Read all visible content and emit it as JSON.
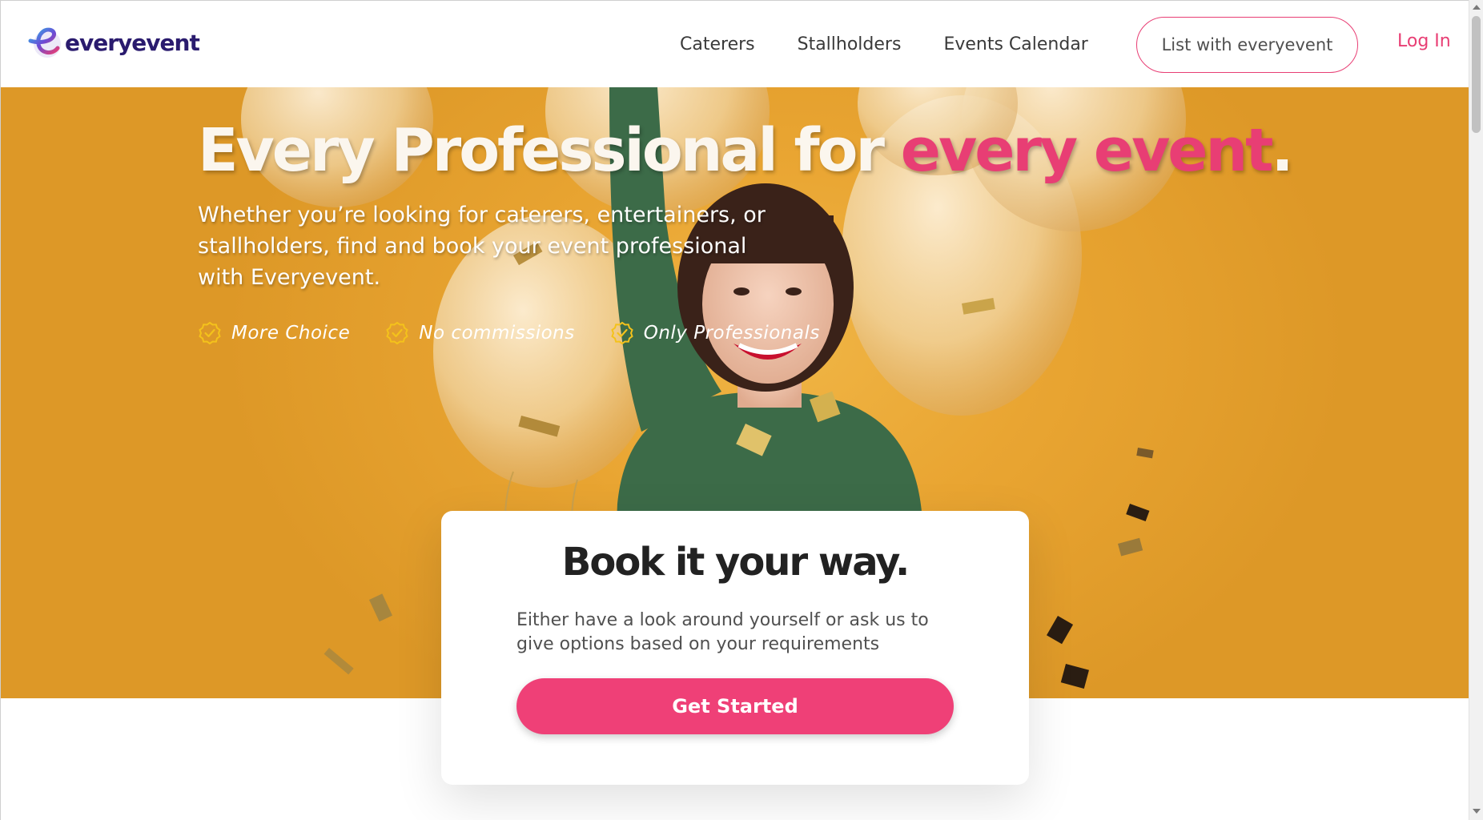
{
  "brand": {
    "name": "everyevent",
    "primary_color": "#e83e74",
    "logo_text_color": "#2a1b6e"
  },
  "nav": {
    "links": [
      "Caterers",
      "Stallholders",
      "Events Calendar"
    ],
    "list_button": "List with everyevent",
    "login": "Log In"
  },
  "hero": {
    "headline_main": "Every Professional for ",
    "headline_accent": "every event",
    "headline_end": ".",
    "subtext": "Whether you’re looking for caterers, entertainers, or stallholders, find and book your event professional with Everyevent.",
    "features": [
      "More Choice",
      "No commissions",
      "Only Professionals"
    ],
    "feature_icon": "check-badge-icon",
    "background_color": "#e9a532"
  },
  "card": {
    "title": "Book it your way.",
    "description": "Either have a look around yourself or ask us to give options based on your requirements",
    "cta_label": "Get Started"
  }
}
